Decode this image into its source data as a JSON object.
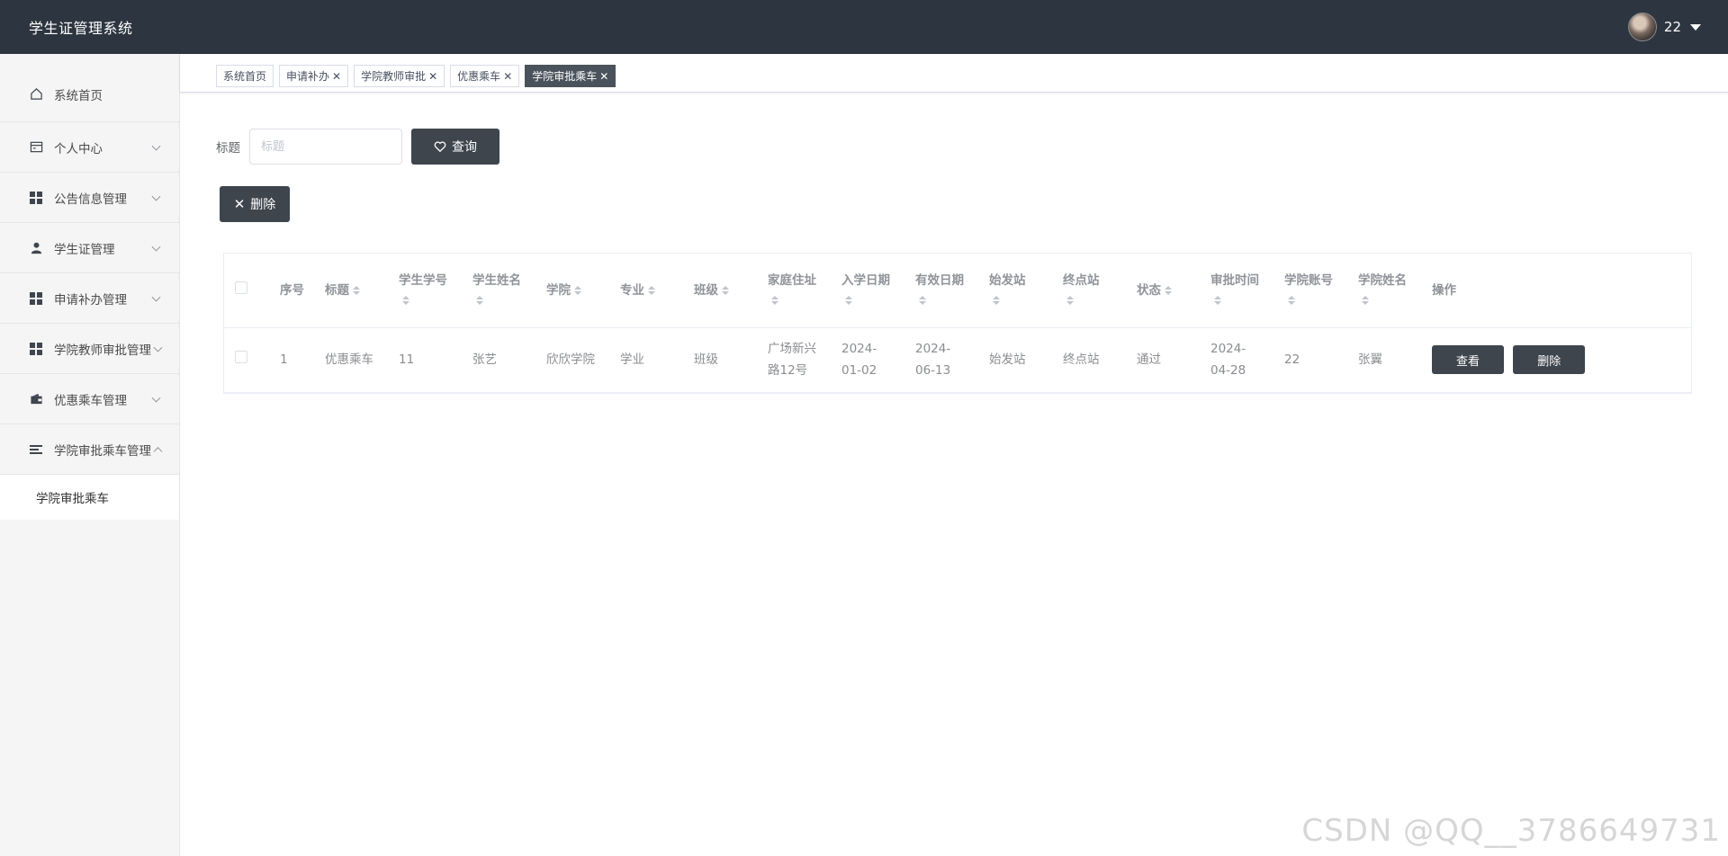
{
  "header": {
    "title": "学生证管理系统",
    "username": "22"
  },
  "sidebar": {
    "items": [
      {
        "label": "系统首页",
        "icon": "home-icon"
      },
      {
        "label": "个人中心",
        "icon": "card-icon"
      },
      {
        "label": "公告信息管理",
        "icon": "grid-icon"
      },
      {
        "label": "学生证管理",
        "icon": "user-icon"
      },
      {
        "label": "申请补办管理",
        "icon": "grid-icon"
      },
      {
        "label": "学院教师审批管理",
        "icon": "grid-icon"
      },
      {
        "label": "优惠乘车管理",
        "icon": "wallet-icon"
      },
      {
        "label": "学院审批乘车管理",
        "icon": "list-icon"
      }
    ],
    "subitem": "学院审批乘车"
  },
  "tabs": [
    {
      "label": "系统首页",
      "closable": false
    },
    {
      "label": "申请补办",
      "closable": true
    },
    {
      "label": "学院教师审批",
      "closable": true
    },
    {
      "label": "优惠乘车",
      "closable": true
    },
    {
      "label": "学院审批乘车",
      "closable": true,
      "active": true
    }
  ],
  "search": {
    "label": "标题",
    "placeholder": "标题",
    "button": "查询"
  },
  "toolbar": {
    "delete_label": "删除"
  },
  "table": {
    "columns": [
      "序号",
      "标题",
      "学生学号",
      "学生姓名",
      "学院",
      "专业",
      "班级",
      "家庭住址",
      "入学日期",
      "有效日期",
      "始发站",
      "终点站",
      "状态",
      "审批时间",
      "学院账号",
      "学院姓名",
      "操作"
    ],
    "rows": [
      {
        "index": "1",
        "title": "优惠乘车",
        "student_no": "11",
        "student_name": "张艺",
        "college": "欣欣学院",
        "major": "学业",
        "class": "班级",
        "address": "广场新兴路12号",
        "enroll_date": "2024-01-02",
        "valid_date": "2024-06-13",
        "start_station": "始发站",
        "end_station": "终点站",
        "status": "通过",
        "approve_time": "2024-04-28",
        "college_account": "22",
        "college_name": "张翼",
        "view_label": "查看",
        "delete_label": "删除"
      }
    ]
  },
  "watermark": "CSDN @QQ__3786649731",
  "colors": {
    "header_bg": "#2d3640",
    "button_dark": "#3e454d",
    "active_tab": "#4a535c"
  }
}
